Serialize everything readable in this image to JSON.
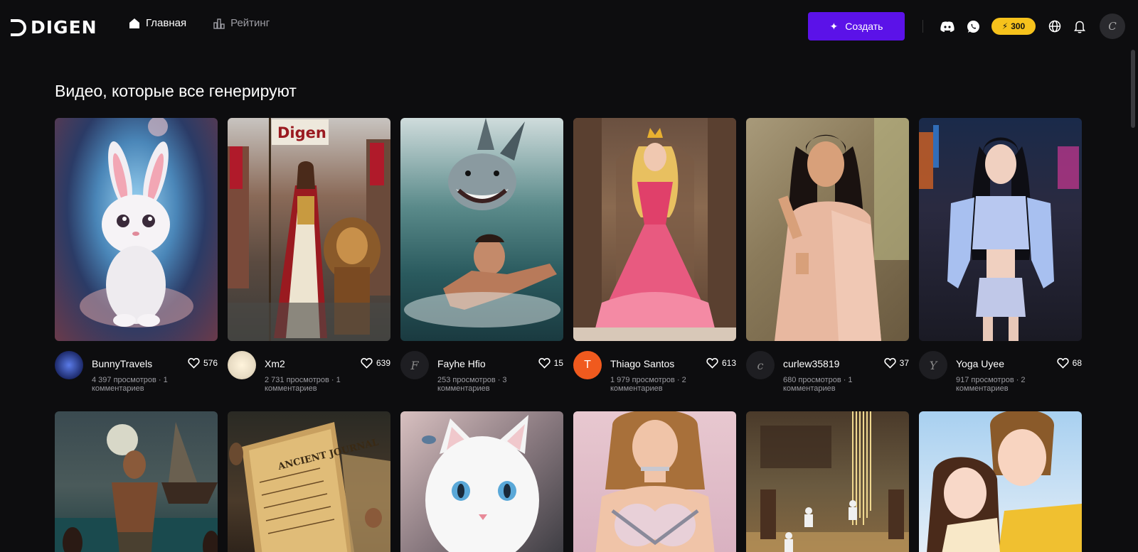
{
  "header": {
    "logo_text": "DIGEN",
    "nav": [
      {
        "label": "Главная",
        "icon": "home-icon",
        "active": true
      },
      {
        "label": "Рейтинг",
        "icon": "ranking-icon",
        "active": false
      }
    ],
    "create_label": "Создать",
    "credits": "300",
    "avatar_initial": "C"
  },
  "section_title": "Видео, которые все генерируют",
  "cards": [
    {
      "user": "BunnyTravels",
      "likes": "576",
      "stats": "4 397 просмотров · 1 комментариев",
      "avatar_type": "image",
      "avatar_color": "#1d2a6b"
    },
    {
      "user": "Xm2",
      "likes": "639",
      "stats": "2 731 просмотров · 1 комментариев",
      "avatar_type": "image",
      "avatar_color": "#e8dcc4"
    },
    {
      "user": "Fayhe Hfio",
      "likes": "15",
      "stats": "253 просмотров · 3 комментариев",
      "avatar_type": "letter",
      "avatar_letter": "F",
      "avatar_color": "#1e1e22"
    },
    {
      "user": "Thiago Santos",
      "likes": "613",
      "stats": "1 979 просмотров · 2 комментариев",
      "avatar_type": "letter",
      "avatar_letter": "T",
      "avatar_color": "#f05a1e"
    },
    {
      "user": "curlew35819",
      "likes": "37",
      "stats": "680 просмотров · 1 комментариев",
      "avatar_type": "letter",
      "avatar_letter": "c",
      "avatar_color": "#1e1e22"
    },
    {
      "user": "Yoga Uyee",
      "likes": "68",
      "stats": "917 просмотров · 2 комментариев",
      "avatar_type": "letter",
      "avatar_letter": "Y",
      "avatar_color": "#1e1e22"
    }
  ],
  "colors": {
    "background": "#0d0d0f",
    "accent": "#5b12e8",
    "credits": "#f6c21c"
  }
}
